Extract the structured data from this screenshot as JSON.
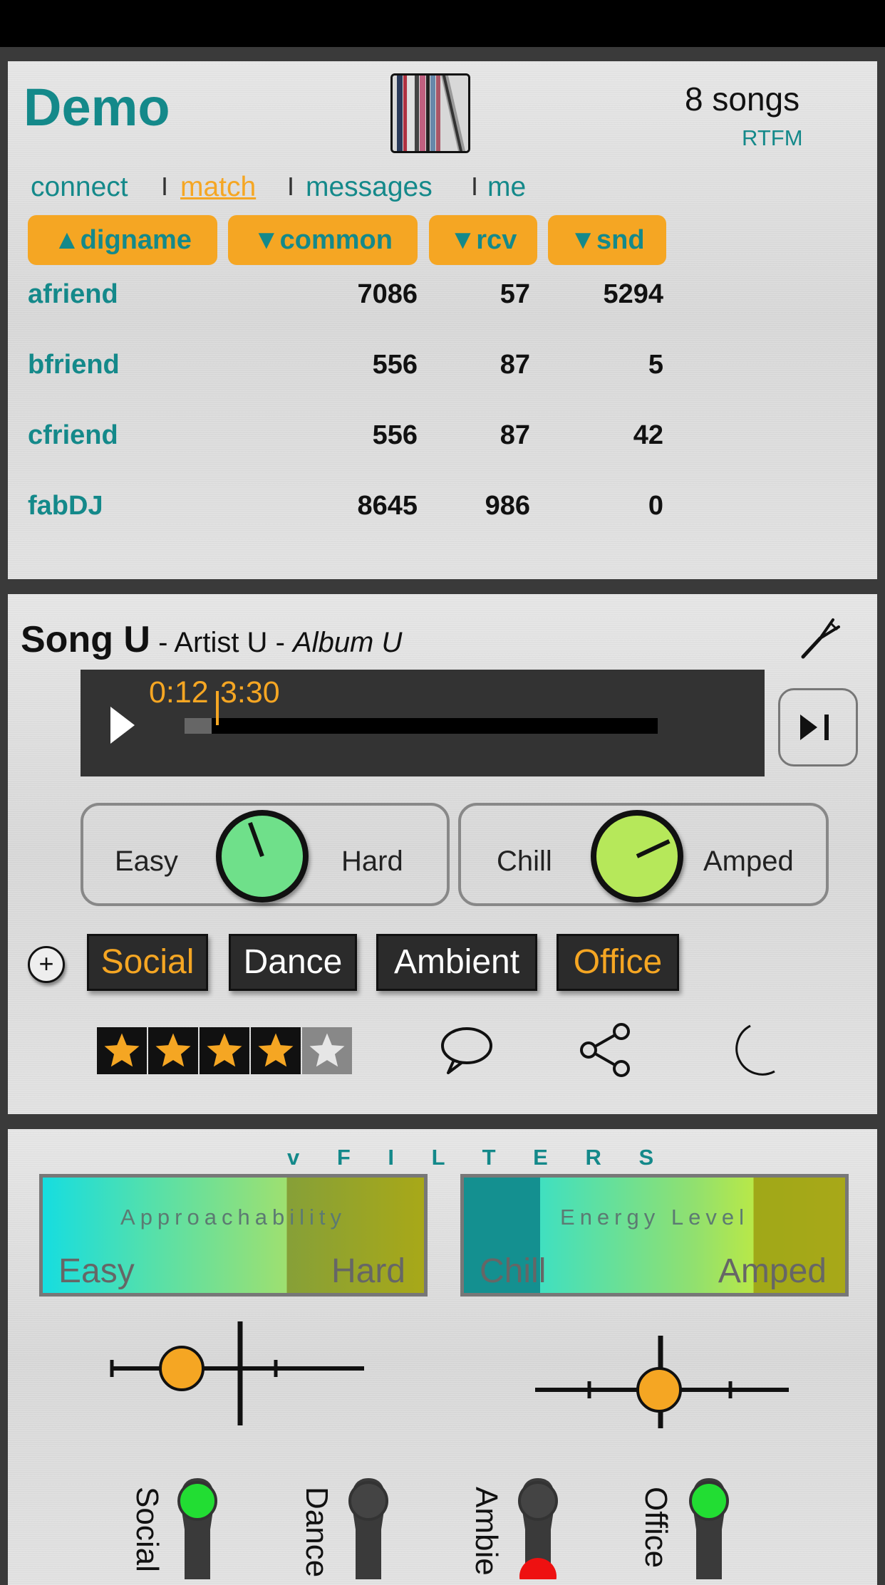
{
  "header": {
    "app_title": "Demo",
    "songs_count": "8 songs",
    "rtfm_link": "RTFM",
    "album_art_icon": "album-stack-icon"
  },
  "nav": {
    "items": [
      {
        "label": "connect",
        "active": false
      },
      {
        "label": "match",
        "active": true
      },
      {
        "label": "messages",
        "active": false
      },
      {
        "label": "me",
        "active": false
      }
    ],
    "separator": "I"
  },
  "table": {
    "headers": [
      "▲digname",
      "▼common",
      "▼rcv",
      "▼snd"
    ],
    "rows": [
      {
        "name": "afriend",
        "common": "7086",
        "rcv": "57",
        "snd": "5294"
      },
      {
        "name": "bfriend",
        "common": "556",
        "rcv": "87",
        "snd": "5"
      },
      {
        "name": "cfriend",
        "common": "556",
        "rcv": "87",
        "snd": "42"
      },
      {
        "name": "fabDJ",
        "common": "8645",
        "rcv": "986",
        "snd": "0"
      }
    ]
  },
  "song": {
    "title": "Song U",
    "sep1": " - ",
    "artist": "Artist U",
    "sep2": " - ",
    "album": "Album U",
    "elapsed": "0:12",
    "duration": "3:30",
    "progress_fraction": 0.057
  },
  "knobs": {
    "approachability": {
      "low": "Easy",
      "high": "Hard",
      "color": "#6fe08a"
    },
    "energy": {
      "low": "Chill",
      "high": "Amped",
      "color": "#b6e85a"
    }
  },
  "tags": [
    {
      "label": "Social",
      "on": true
    },
    {
      "label": "Dance",
      "on": false
    },
    {
      "label": "Ambient",
      "on": false
    },
    {
      "label": "Office",
      "on": true
    }
  ],
  "add_tag_symbol": "+",
  "rating": {
    "value": 4,
    "max": 5
  },
  "filters": {
    "title": "v F I L T E R S",
    "approachability": {
      "title": "Approachability",
      "low": "Easy",
      "high": "Hard"
    },
    "energy": {
      "title": "Energy Level",
      "low": "Chill",
      "high": "Amped"
    },
    "toggles": [
      {
        "label": "Social",
        "on": true
      },
      {
        "label": "Dance",
        "on": false
      },
      {
        "label": "Ambie",
        "on": false
      },
      {
        "label": "Office",
        "on": true
      }
    ]
  },
  "colors": {
    "teal": "#14898a",
    "orange": "#f5a623",
    "led_on": "#22dd33",
    "led_red": "#ee1111"
  }
}
